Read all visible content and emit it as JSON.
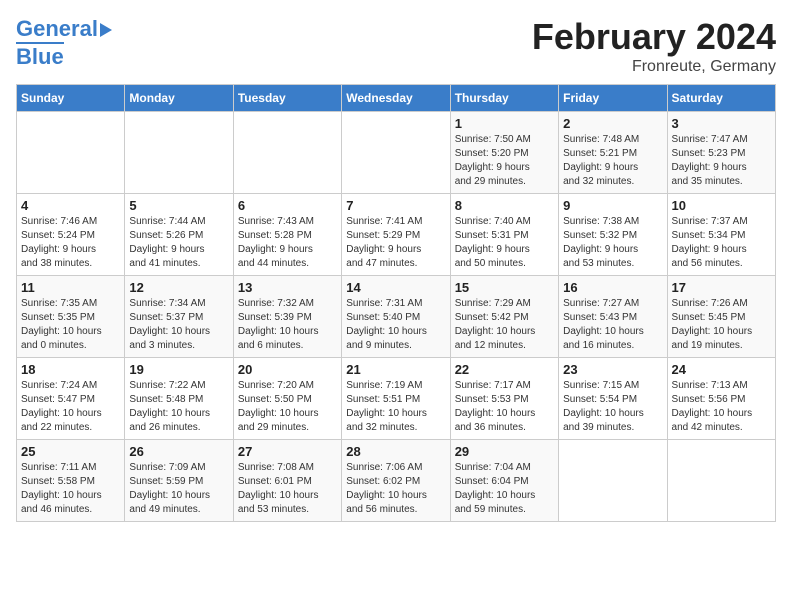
{
  "header": {
    "logo_line1": "General",
    "logo_line2": "Blue",
    "title": "February 2024",
    "subtitle": "Fronreute, Germany"
  },
  "calendar": {
    "days_of_week": [
      "Sunday",
      "Monday",
      "Tuesday",
      "Wednesday",
      "Thursday",
      "Friday",
      "Saturday"
    ],
    "weeks": [
      [
        {
          "num": "",
          "info": ""
        },
        {
          "num": "",
          "info": ""
        },
        {
          "num": "",
          "info": ""
        },
        {
          "num": "",
          "info": ""
        },
        {
          "num": "1",
          "info": "Sunrise: 7:50 AM\nSunset: 5:20 PM\nDaylight: 9 hours\nand 29 minutes."
        },
        {
          "num": "2",
          "info": "Sunrise: 7:48 AM\nSunset: 5:21 PM\nDaylight: 9 hours\nand 32 minutes."
        },
        {
          "num": "3",
          "info": "Sunrise: 7:47 AM\nSunset: 5:23 PM\nDaylight: 9 hours\nand 35 minutes."
        }
      ],
      [
        {
          "num": "4",
          "info": "Sunrise: 7:46 AM\nSunset: 5:24 PM\nDaylight: 9 hours\nand 38 minutes."
        },
        {
          "num": "5",
          "info": "Sunrise: 7:44 AM\nSunset: 5:26 PM\nDaylight: 9 hours\nand 41 minutes."
        },
        {
          "num": "6",
          "info": "Sunrise: 7:43 AM\nSunset: 5:28 PM\nDaylight: 9 hours\nand 44 minutes."
        },
        {
          "num": "7",
          "info": "Sunrise: 7:41 AM\nSunset: 5:29 PM\nDaylight: 9 hours\nand 47 minutes."
        },
        {
          "num": "8",
          "info": "Sunrise: 7:40 AM\nSunset: 5:31 PM\nDaylight: 9 hours\nand 50 minutes."
        },
        {
          "num": "9",
          "info": "Sunrise: 7:38 AM\nSunset: 5:32 PM\nDaylight: 9 hours\nand 53 minutes."
        },
        {
          "num": "10",
          "info": "Sunrise: 7:37 AM\nSunset: 5:34 PM\nDaylight: 9 hours\nand 56 minutes."
        }
      ],
      [
        {
          "num": "11",
          "info": "Sunrise: 7:35 AM\nSunset: 5:35 PM\nDaylight: 10 hours\nand 0 minutes."
        },
        {
          "num": "12",
          "info": "Sunrise: 7:34 AM\nSunset: 5:37 PM\nDaylight: 10 hours\nand 3 minutes."
        },
        {
          "num": "13",
          "info": "Sunrise: 7:32 AM\nSunset: 5:39 PM\nDaylight: 10 hours\nand 6 minutes."
        },
        {
          "num": "14",
          "info": "Sunrise: 7:31 AM\nSunset: 5:40 PM\nDaylight: 10 hours\nand 9 minutes."
        },
        {
          "num": "15",
          "info": "Sunrise: 7:29 AM\nSunset: 5:42 PM\nDaylight: 10 hours\nand 12 minutes."
        },
        {
          "num": "16",
          "info": "Sunrise: 7:27 AM\nSunset: 5:43 PM\nDaylight: 10 hours\nand 16 minutes."
        },
        {
          "num": "17",
          "info": "Sunrise: 7:26 AM\nSunset: 5:45 PM\nDaylight: 10 hours\nand 19 minutes."
        }
      ],
      [
        {
          "num": "18",
          "info": "Sunrise: 7:24 AM\nSunset: 5:47 PM\nDaylight: 10 hours\nand 22 minutes."
        },
        {
          "num": "19",
          "info": "Sunrise: 7:22 AM\nSunset: 5:48 PM\nDaylight: 10 hours\nand 26 minutes."
        },
        {
          "num": "20",
          "info": "Sunrise: 7:20 AM\nSunset: 5:50 PM\nDaylight: 10 hours\nand 29 minutes."
        },
        {
          "num": "21",
          "info": "Sunrise: 7:19 AM\nSunset: 5:51 PM\nDaylight: 10 hours\nand 32 minutes."
        },
        {
          "num": "22",
          "info": "Sunrise: 7:17 AM\nSunset: 5:53 PM\nDaylight: 10 hours\nand 36 minutes."
        },
        {
          "num": "23",
          "info": "Sunrise: 7:15 AM\nSunset: 5:54 PM\nDaylight: 10 hours\nand 39 minutes."
        },
        {
          "num": "24",
          "info": "Sunrise: 7:13 AM\nSunset: 5:56 PM\nDaylight: 10 hours\nand 42 minutes."
        }
      ],
      [
        {
          "num": "25",
          "info": "Sunrise: 7:11 AM\nSunset: 5:58 PM\nDaylight: 10 hours\nand 46 minutes."
        },
        {
          "num": "26",
          "info": "Sunrise: 7:09 AM\nSunset: 5:59 PM\nDaylight: 10 hours\nand 49 minutes."
        },
        {
          "num": "27",
          "info": "Sunrise: 7:08 AM\nSunset: 6:01 PM\nDaylight: 10 hours\nand 53 minutes."
        },
        {
          "num": "28",
          "info": "Sunrise: 7:06 AM\nSunset: 6:02 PM\nDaylight: 10 hours\nand 56 minutes."
        },
        {
          "num": "29",
          "info": "Sunrise: 7:04 AM\nSunset: 6:04 PM\nDaylight: 10 hours\nand 59 minutes."
        },
        {
          "num": "",
          "info": ""
        },
        {
          "num": "",
          "info": ""
        }
      ]
    ]
  }
}
